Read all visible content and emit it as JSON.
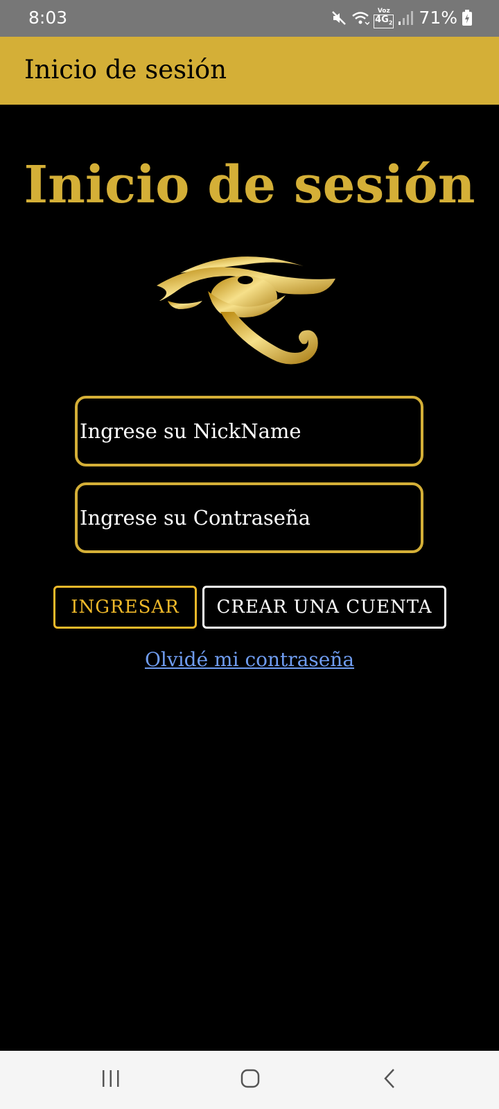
{
  "status_bar": {
    "time": "8:03",
    "network_top": "Voz",
    "network_type": "4G",
    "network_sub": "2",
    "battery_percent": "71%",
    "icons": [
      "mute-icon",
      "wifi-icon",
      "signal-icon",
      "battery-icon"
    ]
  },
  "app_bar": {
    "title": "Inicio de sesión"
  },
  "main": {
    "heading": "Inicio de sesión",
    "logo_icon": "eye-of-horus-icon",
    "nickname_placeholder": "Ingrese su NickName",
    "nickname_value": "",
    "password_placeholder": "Ingrese su Contraseña",
    "password_value": "",
    "login_label": "INGRESAR",
    "create_account_label": "CREAR UNA CUENTA",
    "forgot_password_label": "Olvidé mi contraseña"
  },
  "nav_bar": {
    "icons": [
      "recent-apps-icon",
      "home-icon",
      "back-icon"
    ]
  },
  "colors": {
    "app_bar": "#d4af37",
    "heading": "#d4af37",
    "input_border": "#d4af37",
    "login_button": "#f0b92a",
    "link": "#6f9cf0",
    "background": "#000000",
    "status_bar": "#777777"
  }
}
